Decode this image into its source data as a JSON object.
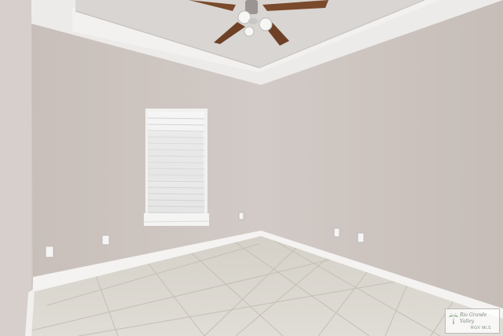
{
  "scene": {
    "description_free": true,
    "colors": {
      "wall_left": "#cbc2bd",
      "wall_back": "#c9c0bb",
      "wall_right": "#ccc3bf",
      "ceiling": "#ebe8e6",
      "tray_inner": "#dcd8d5",
      "baseboard": "#f4f3f1",
      "floor": "#d9d5cd",
      "grout": "#c2bdb3",
      "fan_blade": "#7a4a2c"
    },
    "icons": [
      "ceiling-fan-icon",
      "window-blinds",
      "outlet-icon"
    ]
  },
  "watermark": {
    "line1": "Rio Grande Valley",
    "line2": "RGV MLS"
  }
}
